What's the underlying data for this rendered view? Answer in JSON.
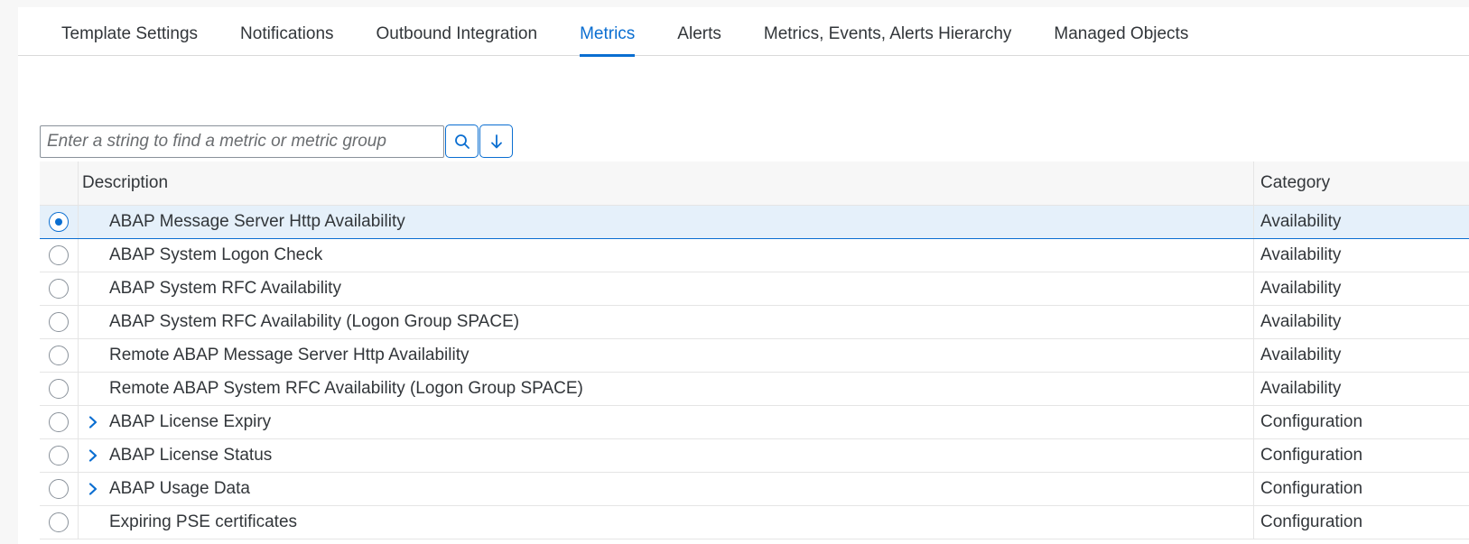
{
  "tabs": [
    {
      "label": "Template Settings",
      "active": false
    },
    {
      "label": "Notifications",
      "active": false
    },
    {
      "label": "Outbound Integration",
      "active": false
    },
    {
      "label": "Metrics",
      "active": true
    },
    {
      "label": "Alerts",
      "active": false
    },
    {
      "label": "Metrics, Events, Alerts Hierarchy",
      "active": false
    },
    {
      "label": "Managed Objects",
      "active": false
    }
  ],
  "search": {
    "placeholder": "Enter a string to find a metric or metric group",
    "value": "",
    "search_icon": "search-icon",
    "next_icon": "arrow-down-icon"
  },
  "table": {
    "columns": {
      "description": "Description",
      "category": "Category"
    },
    "rows": [
      {
        "description": "ABAP Message Server Http Availability",
        "category": "Availability",
        "expandable": false,
        "selected": true
      },
      {
        "description": "ABAP System Logon Check",
        "category": "Availability",
        "expandable": false,
        "selected": false
      },
      {
        "description": "ABAP System RFC Availability",
        "category": "Availability",
        "expandable": false,
        "selected": false
      },
      {
        "description": "ABAP System RFC Availability (Logon Group SPACE)",
        "category": "Availability",
        "expandable": false,
        "selected": false
      },
      {
        "description": "Remote ABAP Message Server Http Availability",
        "category": "Availability",
        "expandable": false,
        "selected": false
      },
      {
        "description": "Remote ABAP System RFC Availability (Logon Group SPACE)",
        "category": "Availability",
        "expandable": false,
        "selected": false
      },
      {
        "description": "ABAP License Expiry",
        "category": "Configuration",
        "expandable": true,
        "selected": false
      },
      {
        "description": "ABAP License Status",
        "category": "Configuration",
        "expandable": true,
        "selected": false
      },
      {
        "description": "ABAP Usage Data",
        "category": "Configuration",
        "expandable": true,
        "selected": false
      },
      {
        "description": "Expiring PSE certificates",
        "category": "Configuration",
        "expandable": false,
        "selected": false
      }
    ]
  },
  "colors": {
    "accent": "#0a6ed1",
    "text": "#32363a",
    "selected_row": "#e5f0fa",
    "header_bg": "#f7f7f7"
  }
}
